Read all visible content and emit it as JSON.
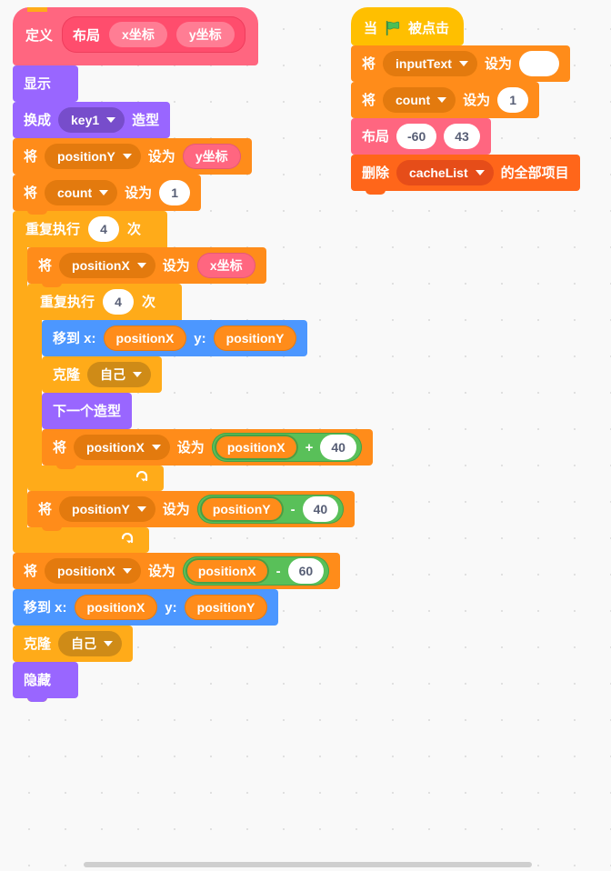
{
  "workspace": {
    "background_color": "#f9f9f9",
    "grid_dot_color": "#e0e0e0"
  },
  "scripts": {
    "definition_script": {
      "define": {
        "keyword": "定义",
        "proc_name": "布局",
        "args": [
          "x坐标",
          "y坐标"
        ],
        "color": "#ff6680"
      },
      "blocks": [
        {
          "name": "show",
          "label": "显示",
          "color": "#9966ff"
        },
        {
          "name": "switch-costume",
          "label_before": "换成",
          "dropdown": "key1",
          "label_after": "造型",
          "color": "#9966ff"
        },
        {
          "name": "set-positionY",
          "label_before": "将",
          "dropdown": "positionY",
          "label_mid": "设为",
          "value": "y坐标",
          "value_kind": "param",
          "color": "#ff8c1a"
        },
        {
          "name": "set-count",
          "label_before": "将",
          "dropdown": "count",
          "label_mid": "设为",
          "value": "1",
          "value_kind": "number",
          "color": "#ff8c1a"
        }
      ],
      "outer_repeat": {
        "name": "repeat-outer",
        "label_before": "重复执行",
        "times": "4",
        "label_after": "次",
        "color": "#ffab19",
        "children": {
          "set_positionX": {
            "label_before": "将",
            "dropdown": "positionX",
            "label_mid": "设为",
            "value": "x坐标",
            "value_kind": "param"
          },
          "inner_repeat": {
            "name": "repeat-inner",
            "label_before": "重复执行",
            "times": "4",
            "label_after": "次",
            "children": [
              {
                "name": "goto-xy",
                "label_before": "移到 x:",
                "x_value": "positionX",
                "label_mid": "y:",
                "y_value": "positionY",
                "color": "#4c97ff"
              },
              {
                "name": "create-clone",
                "label_before": "克隆",
                "dropdown": "自己",
                "color": "#ffab19"
              },
              {
                "name": "next-costume",
                "label": "下一个造型",
                "color": "#9966ff"
              },
              {
                "name": "change-positionX",
                "label_before": "将",
                "dropdown": "positionX",
                "label_mid": "设为",
                "operand_a": "positionX",
                "operator": "+",
                "operand_b": "40",
                "color": "#ff8c1a",
                "op_color": "#59c059"
              }
            ]
          },
          "set_positionY_after": {
            "label_before": "将",
            "dropdown": "positionY",
            "label_mid": "设为",
            "operand_a": "positionY",
            "operator": "-",
            "operand_b": "40"
          }
        }
      },
      "tail_blocks": [
        {
          "name": "set-positionX-minus-60",
          "label_before": "将",
          "dropdown": "positionX",
          "label_mid": "设为",
          "operand_a": "positionX",
          "operator": "-",
          "operand_b": "60",
          "color": "#ff8c1a"
        },
        {
          "name": "goto-xy-final",
          "label_before": "移到 x:",
          "x_value": "positionX",
          "label_mid": "y:",
          "y_value": "positionY",
          "color": "#4c97ff"
        },
        {
          "name": "create-clone-final",
          "label_before": "克隆",
          "dropdown": "自己",
          "color": "#ffab19"
        },
        {
          "name": "hide",
          "label": "隐藏",
          "color": "#9966ff"
        }
      ]
    },
    "flag_script": {
      "hat": {
        "name": "when-flag-clicked",
        "label_before": "当",
        "icon": "green-flag-icon",
        "label_after": "被点击",
        "color": "#ffbf00",
        "flag_color": "#4cbf56"
      },
      "blocks": [
        {
          "name": "set-inputText",
          "label_before": "将",
          "dropdown": "inputText",
          "label_mid": "设为",
          "value": "",
          "value_kind": "text",
          "color": "#ff8c1a"
        },
        {
          "name": "set-count",
          "label_before": "将",
          "dropdown": "count",
          "label_mid": "设为",
          "value": "1",
          "value_kind": "number",
          "color": "#ff8c1a"
        },
        {
          "name": "call-layout",
          "label": "布局",
          "arg1": "-60",
          "arg2": "43",
          "color": "#ff6680"
        },
        {
          "name": "delete-all-of-list",
          "label_before": "删除",
          "dropdown": "cacheList",
          "label_after": "的全部项目",
          "color": "#ff661a"
        }
      ]
    }
  },
  "scrollbar": {
    "name": "horizontal-scrollbar",
    "color": "#cfcfcf"
  }
}
